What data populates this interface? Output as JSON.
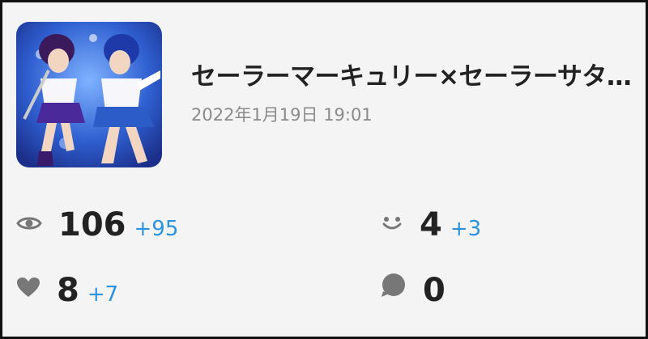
{
  "post": {
    "title": "セーラーマーキュリー×セーラーサタ…",
    "date": "2022年1月19日 19:01",
    "thumbnail_icon": "illustration-thumbnail"
  },
  "stats": {
    "views": {
      "icon": "eye-icon",
      "value": "106",
      "delta": "+95"
    },
    "reactions": {
      "icon": "smile-icon",
      "value": "4",
      "delta": "+3"
    },
    "likes": {
      "icon": "heart-icon",
      "value": "8",
      "delta": "+7"
    },
    "comments": {
      "icon": "comment-bubble-icon",
      "value": "0"
    }
  },
  "colors": {
    "background": "#f4f4f4",
    "text": "#222222",
    "muted": "#8a8a8a",
    "accent": "#2a93e0",
    "icon": "#777777"
  }
}
